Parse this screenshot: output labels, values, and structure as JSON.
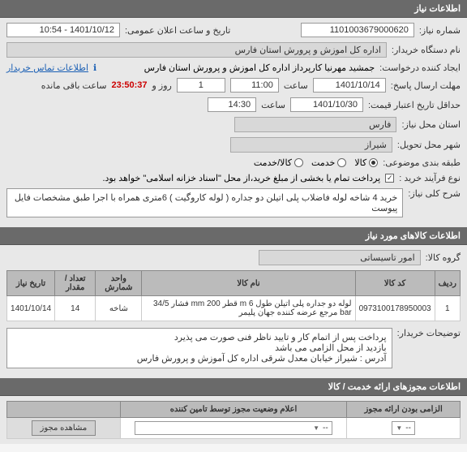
{
  "sections": {
    "need_info": "اطلاعات نیاز",
    "need_items": "اطلاعات کالاهای مورد نیاز",
    "permits": "اطلاعات مجوزهای ارائه خدمت / کالا"
  },
  "labels": {
    "need_number": "شماره نیاز:",
    "public_date": "تاریخ و ساعت اعلان عمومی:",
    "buyer_org": "نام دستگاه خریدار:",
    "creator": "ایجاد کننده درخواست:",
    "send_deadline": "مهلت ارسال پاسخ:",
    "hour": "ساعت",
    "day_and": "روز و",
    "remaining": "ساعت باقی مانده",
    "price_valid": "حداقل تاریخ اعتبار قیمت:",
    "need_location": "استان محل نیاز:",
    "delivery_city": "شهر محل تحویل:",
    "classification": "طبقه بندی موضوعی:",
    "buy_process": "نوع فرآیند خرید :",
    "buy_process_note": "پرداخت تمام یا بخشی از مبلغ خرید،از محل \"اسناد خزانه اسلامی\" خواهد بود.",
    "need_desc": "شرح کلی نیاز:",
    "goods_group": "گروه کالا:",
    "buyer_notes": "توضیحات خریدار:",
    "permit_required": "الزامی بودن ارائه مجوز",
    "permit_status": "اعلام وضعیت مجوز توسط تامین کننده",
    "view_permit": "مشاهده مجوز",
    "contact_info": "اطلاعات تماس خریدار"
  },
  "values": {
    "need_number": "1101003679000620",
    "public_date": "1401/10/12 - 10:54",
    "buyer_org": "اداره کل اموزش و پرورش استان فارس",
    "creator": "جمشید مهرنیا کارپرداز اداره کل اموزش و پرورش استان فارس",
    "send_date": "1401/10/14",
    "send_time": "11:00",
    "days_left": "1",
    "countdown": "23:50:37",
    "price_date": "1401/10/30",
    "price_time": "14:30",
    "province": "فارس",
    "city": "شیراز",
    "need_desc": "خرید 4 شاخه لوله فاضلاب پلی اتیلن دو جداره ( لوله کاروگیت ) 6متری همراه با اجرا  طبق مشخصات فایل پیوست",
    "goods_group": "امور تاسیساتی",
    "buyer_notes": "پرداخت پس از اتمام کار و تایید ناظر فنی صورت می پذیرد\nبازدید از محل الزامی می باشد\nآدرس : شیراز خیابان معدل شرقی اداره کل آموزش و پرورش فارس"
  },
  "classification_options": {
    "goods": "کالا",
    "service": "خدمت",
    "goods_service": "کالا/خدمت"
  },
  "table": {
    "headers": {
      "row": "ردیف",
      "code": "کد کالا",
      "name": "نام کالا",
      "unit": "واحد شمارش",
      "qty": "تعداد / مقدار",
      "date": "تاریخ نیاز"
    },
    "rows": [
      {
        "row": "1",
        "code": "0973100178950003",
        "name": "لوله دو جداره پلی اتیلن طول m 6 قطر mm 200 فشار 34/5 bar مرجع عرضه کننده جهان پلیمر",
        "unit": "شاخه",
        "qty": "14",
        "date": "1401/10/14"
      }
    ]
  },
  "permit_select": "--"
}
